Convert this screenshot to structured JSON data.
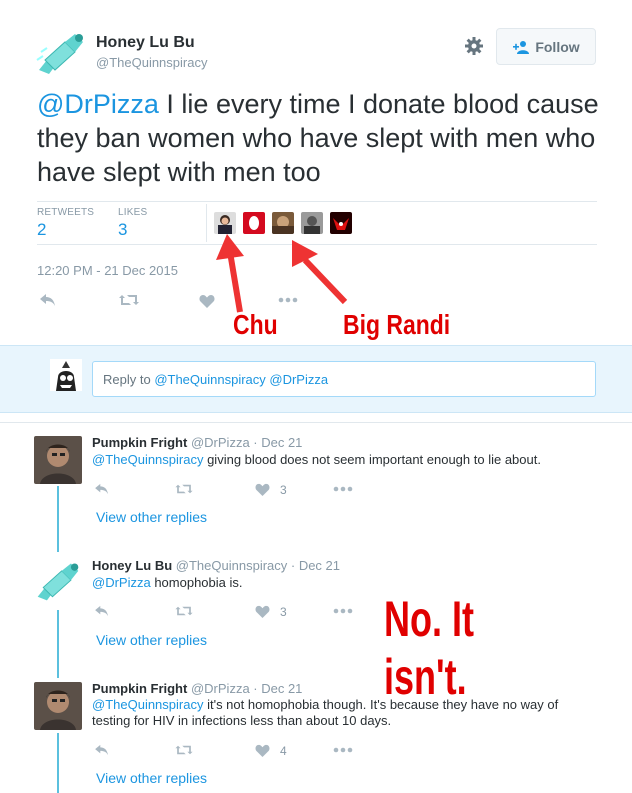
{
  "tweet": {
    "author_name": "Honey Lu Bu",
    "author_handle": "@TheQuinnspiracy",
    "follow_label": "Follow",
    "text_mention": "@DrPizza",
    "text_body": " I lie every time I donate blood cause they ban women who have slept with men who have slept with men too",
    "retweets_label": "RETWEETS",
    "retweets_count": "2",
    "likes_label": "LIKES",
    "likes_count": "3",
    "timestamp": "12:20 PM - 21 Dec 2015"
  },
  "annotations": {
    "chu": "Chu",
    "big_randi": "Big Randi",
    "no_it_isnt": "No. It isn't."
  },
  "reply_box": {
    "prefix": "Reply to ",
    "mentions": "@TheQuinnspiracy @DrPizza"
  },
  "replies": [
    {
      "name": "Pumpkin Fright",
      "meta": "@DrPizza · Dec 21",
      "mention": "@TheQuinnspiracy",
      "text": " giving blood does not seem important enough to lie about.",
      "likes": "3",
      "view_replies": "View other replies"
    },
    {
      "name": "Honey Lu Bu",
      "meta": "@TheQuinnspiracy · Dec 21",
      "mention": "@DrPizza",
      "text": " homophobia is.",
      "likes": "3",
      "view_replies": "View other replies"
    },
    {
      "name": "Pumpkin Fright",
      "meta": "@DrPizza · Dec 21",
      "mention": "@TheQuinnspiracy",
      "text": " it's not homophobia though. It's because they have no way of testing for HIV in infections less than about 10 days.",
      "likes": "4",
      "view_replies": "View other replies"
    }
  ],
  "colors": {
    "link": "#1b95e0",
    "muted": "#8899a6",
    "annotation": "#e00000",
    "thread_line": "#5bc0de"
  }
}
